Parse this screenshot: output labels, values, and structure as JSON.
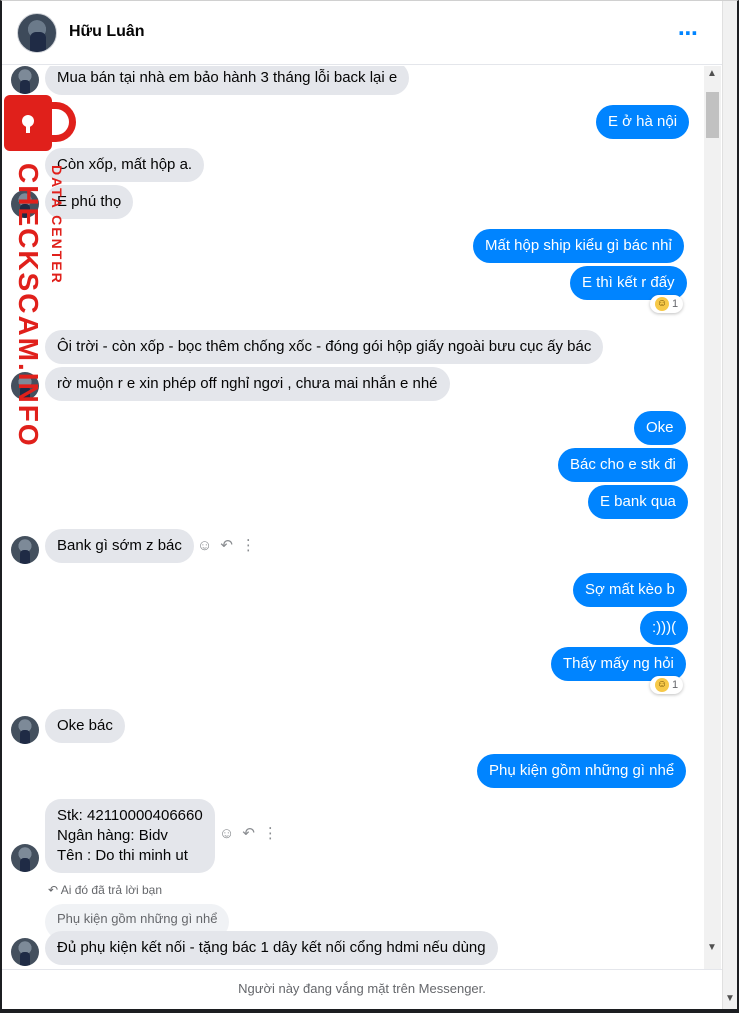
{
  "header": {
    "contact_name": "Hữu Luân",
    "more_icon": "⋯"
  },
  "messages": [
    {
      "dir": "in",
      "text": "Mua bán tại nhà em bảo hành 3 tháng lỗi back lại e"
    },
    {
      "dir": "out",
      "text": "E ở hà nội"
    },
    {
      "dir": "in",
      "text": "Còn xốp, mất hộp a."
    },
    {
      "dir": "in",
      "text": "E phú thọ"
    },
    {
      "dir": "out",
      "text": "Mất hộp ship kiểu gì bác nhỉ"
    },
    {
      "dir": "out",
      "text": "E thì kết r đấy",
      "reaction": {
        "emoji": "😆",
        "count": "1"
      }
    },
    {
      "dir": "in",
      "text": "Ôi trời - còn xốp - bọc thêm chống xốc - đóng gói hộp giấy ngoài bưu cục ấy bác"
    },
    {
      "dir": "in",
      "text": "rờ muộn r e xin phép off nghỉ ngơi , chưa mai nhắn e nhé"
    },
    {
      "dir": "out",
      "text": "Oke"
    },
    {
      "dir": "out",
      "text": "Bác cho e stk đi"
    },
    {
      "dir": "out",
      "text": "E bank qua"
    },
    {
      "dir": "in",
      "text": "Bank gì sớm z bác"
    },
    {
      "dir": "out",
      "text": "Sợ mất kèo b"
    },
    {
      "dir": "out",
      "text": ":)))("
    },
    {
      "dir": "out",
      "text": "Thấy mấy ng hỏi",
      "reaction": {
        "emoji": "😆",
        "count": "1"
      }
    },
    {
      "dir": "in",
      "text": "Oke bác"
    },
    {
      "dir": "out",
      "text": "Phụ kiện gồm những gì nhể"
    },
    {
      "dir": "in",
      "lines": [
        "Stk: 42110000406660",
        "Ngân hàng: Bidv",
        "Tên : Do thi minh ut"
      ]
    },
    {
      "dir": "in",
      "text": "Đủ phụ kiện kết nối - tặng bác 1 dây kết nối cổng hdmi nếu dùng"
    }
  ],
  "reply": {
    "note": "Ai đó đã trả lời bạn",
    "quoted": "Phụ kiện gồm những gì nhể"
  },
  "footer": {
    "status": "Người này đang vắng mặt trên Messenger."
  },
  "watermark": {
    "main": "CHECKSCAM.INFO",
    "sub": "DATA CENTER"
  },
  "colors": {
    "outgoing": "#0084ff",
    "incoming": "#e4e6eb",
    "watermark": "#e0201b"
  }
}
